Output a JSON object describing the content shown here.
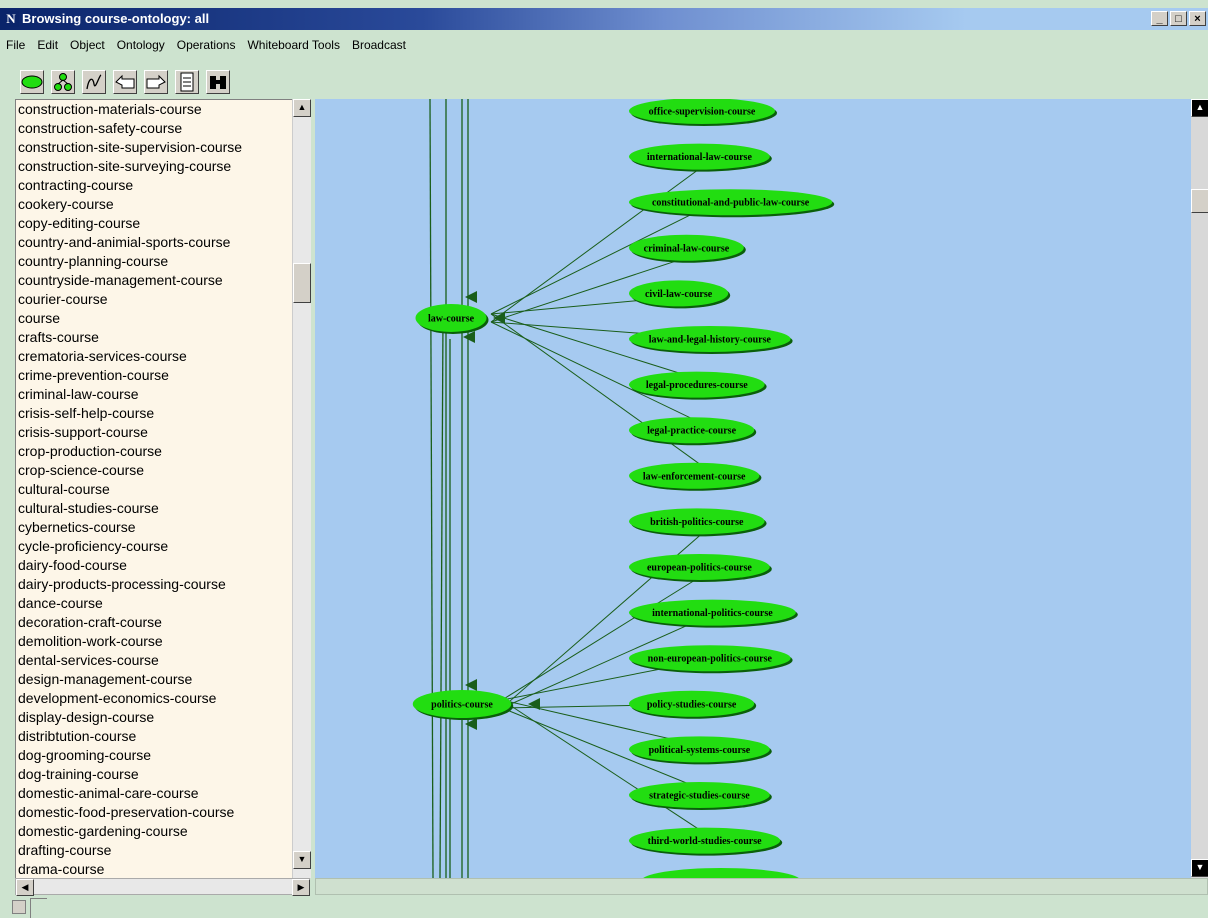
{
  "window": {
    "title": "Browsing course-ontology: all",
    "app_icon_letter": "N",
    "minimize": "_",
    "maximize": "□",
    "close": "×"
  },
  "menu": [
    "File",
    "Edit",
    "Object",
    "Ontology",
    "Operations",
    "Whiteboard Tools",
    "Broadcast"
  ],
  "toolbar": {
    "icons": [
      "ellipse-node-icon",
      "hierarchy-icon",
      "draw-tool-icon",
      "back-arrow-icon",
      "forward-arrow-icon",
      "document-icon",
      "binoculars-icon"
    ]
  },
  "course_list": [
    "construction-materials-course",
    "construction-safety-course",
    "construction-site-supervision-course",
    "construction-site-surveying-course",
    "contracting-course",
    "cookery-course",
    "copy-editing-course",
    "country-and-animial-sports-course",
    "country-planning-course",
    "countryside-management-course",
    "courier-course",
    "course",
    "crafts-course",
    "crematoria-services-course",
    "crime-prevention-course",
    "criminal-law-course",
    "crisis-self-help-course",
    "crisis-support-course",
    "crop-production-course",
    "crop-science-course",
    "cultural-course",
    "cultural-studies-course",
    "cybernetics-course",
    "cycle-proficiency-course",
    "dairy-food-course",
    "dairy-products-processing-course",
    "dance-course",
    "decoration-craft-course",
    "demolition-work-course",
    "dental-services-course",
    "design-management-course",
    "development-economics-course",
    "display-design-course",
    "distribtution-course",
    "dog-grooming-course",
    "dog-training-course",
    "domestic-animal-care-course",
    "domestic-food-preservation-course",
    "domestic-gardening-course",
    "drafting-course",
    "drama-course"
  ],
  "graph": {
    "parents": [
      {
        "id": "law",
        "label": "law-course"
      },
      {
        "id": "politics",
        "label": "politics-course"
      }
    ],
    "children": [
      {
        "label": "office-supervision-course",
        "parent": null
      },
      {
        "label": "international-law-course",
        "parent": "law"
      },
      {
        "label": "constitutional-and-public-law-course",
        "parent": "law"
      },
      {
        "label": "criminal-law-course",
        "parent": "law"
      },
      {
        "label": "civil-law-course",
        "parent": "law"
      },
      {
        "label": "law-and-legal-history-course",
        "parent": "law"
      },
      {
        "label": "legal-procedures-course",
        "parent": "law"
      },
      {
        "label": "legal-practice-course",
        "parent": "law"
      },
      {
        "label": "law-enforcement-course",
        "parent": "law"
      },
      {
        "label": "british-politics-course",
        "parent": "politics"
      },
      {
        "label": "european-politics-course",
        "parent": "politics"
      },
      {
        "label": "international-politics-course",
        "parent": "politics"
      },
      {
        "label": "non-european-politics-course",
        "parent": "politics"
      },
      {
        "label": "policy-studies-course",
        "parent": "politics"
      },
      {
        "label": "political-systems-course",
        "parent": "politics"
      },
      {
        "label": "strategic-studies-course",
        "parent": "politics"
      },
      {
        "label": "third-world-studies-course",
        "parent": "politics"
      }
    ],
    "colors": {
      "background": "#a6caf0",
      "node": "#22dd11",
      "edge": "#1a5e1a"
    }
  }
}
